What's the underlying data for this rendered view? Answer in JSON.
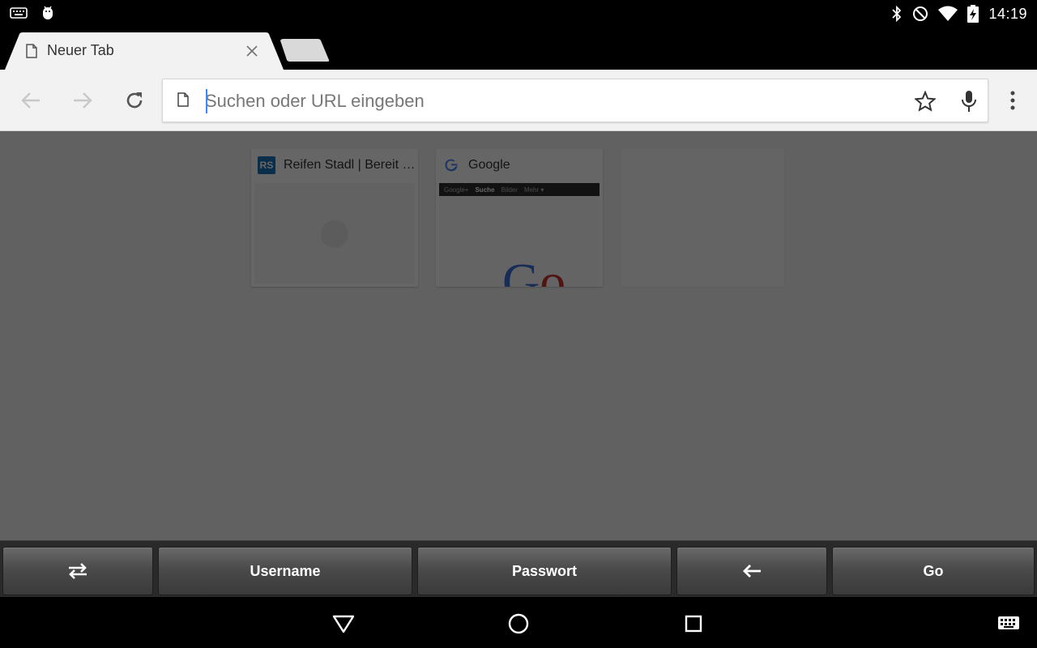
{
  "status_bar": {
    "time": "14:19",
    "icons_left": [
      "keyboard-icon",
      "android-debug-icon"
    ],
    "icons_right": [
      "bluetooth-icon",
      "do-not-disturb-icon",
      "wifi-icon",
      "battery-charging-icon"
    ]
  },
  "tabs": [
    {
      "title": "Neuer Tab",
      "active": true
    }
  ],
  "toolbar": {
    "omnibox_placeholder": "Suchen oder URL eingeben",
    "omnibox_value": ""
  },
  "most_visited": [
    {
      "title": "Reifen Stadl | Bereit f...",
      "favicon_text": "RS"
    },
    {
      "title": "Google",
      "thumb_nav": [
        "Google+",
        "Suche",
        "Bilder",
        "Mehr ▾"
      ],
      "logo_text": "Go"
    },
    {
      "title": ""
    }
  ],
  "accessory_keys": [
    {
      "label": "",
      "icon": "swap-arrows-icon"
    },
    {
      "label": "Username"
    },
    {
      "label": "Passwort"
    },
    {
      "label": "",
      "icon": "arrow-left-icon"
    },
    {
      "label": "Go"
    }
  ],
  "colors": {
    "accent": "#4285f4",
    "toolbar_bg": "#f2f2f2",
    "rs_favicon": "#1a74b8"
  }
}
